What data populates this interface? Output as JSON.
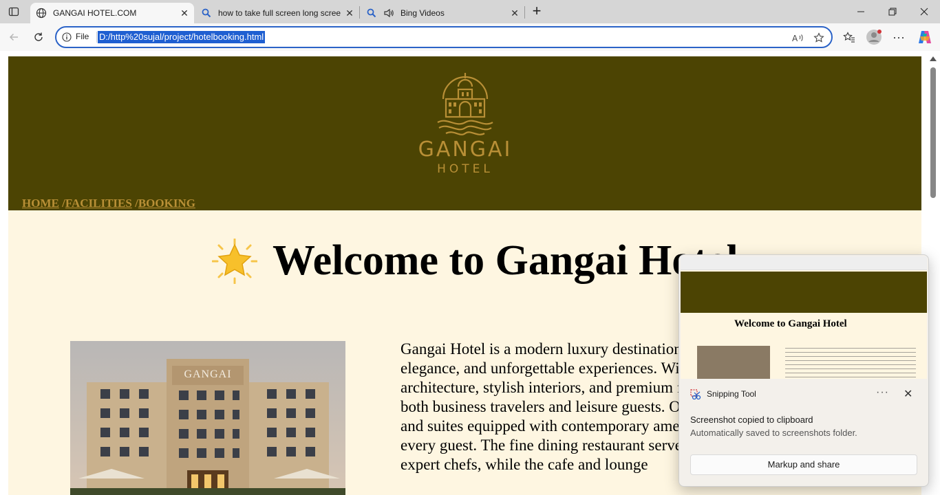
{
  "browser": {
    "tabs": [
      {
        "label": "GANGAI HOTEL.COM",
        "active": true
      },
      {
        "label": "how to take full screen long scree",
        "active": false
      },
      {
        "label": "Bing Videos",
        "active": false
      }
    ],
    "address": {
      "prefix": "File",
      "url": "D:/http%20sujal/project/hotelbooking.html"
    },
    "colors": {
      "accent": "#2a62c7",
      "selection": "#1f5fd1"
    }
  },
  "site": {
    "logo": {
      "name": "GANGAI",
      "sub": "HOTEL"
    },
    "nav": {
      "home": "HOME",
      "sep1": " /",
      "facilities": "FACILITIES",
      "sep2": " /",
      "booking": "BOOKING"
    },
    "heading": "Welcome to Gangai Hotel",
    "building_sign": "GANGAI",
    "intro": "Gangai Hotel is a modern luxury destination designed to offer comfort, elegance, and unforgettable experiences. With its sophisticated multi-story architecture, stylish interiors, and premium facilities, it is the perfect place for both business travelers and leisure guests. Our hotel features spacious rooms and suites equipped with contemporary amenities, ensuring a relaxing stay for every guest. The fine dining restaurant serves delicious cuisines prepared by expert chefs, while the cafe and lounge",
    "colors": {
      "header_bg": "#4c4403",
      "gold": "#b88f36",
      "page_bg": "#fef6e1"
    }
  },
  "toast": {
    "app": "Snipping Tool",
    "title": "Screenshot copied to clipboard",
    "body": "Automatically saved to screenshots folder.",
    "button": "Markup and share",
    "more": "···",
    "thumbnail_heading": "Welcome to Gangai Hotel"
  }
}
